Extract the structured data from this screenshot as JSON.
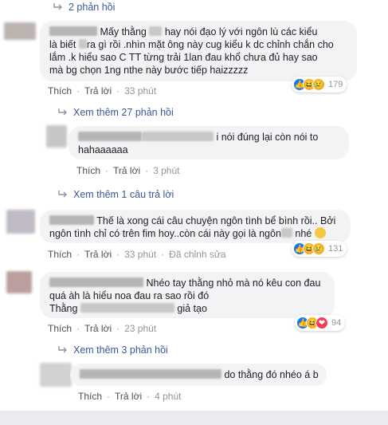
{
  "thread": {
    "top_replies_toggle": "2 phản hồi",
    "comments": [
      {
        "text_line1_a": "Mấy thằng",
        "text_line1_b": "hay nói đạo lý với ngôn lù các kiểu",
        "text_line2_a": "là biết",
        "text_line2_b": "ra gì rồi .nhìn mặt ông này cug kiểu k dc chỉnh chắn cho",
        "text_line3": "lắm .k hiểu sao C TT từng trải 1lan đau khổ chưa đủ hay sao",
        "text_line4": "mà bg chọn 1ng nthe này bước tiếp haizzzzz",
        "like": "Thích",
        "reply": "Trả lời",
        "time": "33 phút",
        "reaction_count": "179",
        "more_replies": "Xem thêm 27 phản hồi"
      },
      {
        "text_line1_a": "Th",
        "text_line1_b": "i nói đúng lại còn nói to",
        "text_line2": "hahaaaaaa",
        "like": "Thích",
        "reply": "Trả lời",
        "time": "3 phút",
        "more_replies": "Xem thêm 1 câu trả lời"
      },
      {
        "text_line1": "Thế là xong cái câu chuyện ngôn tình bể bình rồi.. Bởi",
        "text_line2_a": "ngôn tình chỉ có trên fim hoy..còn cái này gọi là ngôn",
        "text_line2_b": "nhé",
        "like": "Thích",
        "reply": "Trả lời",
        "time": "33 phút",
        "edited": "Đã chỉnh sửa",
        "reaction_count": "131"
      },
      {
        "text_line1": "Nhéo tay thằng nhỏ mà nó kêu con đau",
        "text_line2": "quá àh là hiểu noa đau ra sao rồi đó",
        "text_line3_a": "Thằng",
        "text_line3_b": "giả tạo",
        "like": "Thích",
        "reply": "Trả lời",
        "time": "23 phút",
        "reaction_count": "94",
        "more_replies": "Xem thêm 3 phản hồi"
      },
      {
        "text": "do thằng đó nhéo á b",
        "like": "Thích",
        "reply": "Trả lời",
        "time": "4 phút"
      }
    ]
  },
  "colors": {
    "link": "#385898",
    "bubble": "#f2f3f5",
    "meta": "#90949c",
    "like_blue": "#1877f2",
    "haha_yellow": "#f7b125",
    "love_red": "#f33e58",
    "page_bg_bottom": "#e9ebee"
  },
  "icons": [
    "reply-arrow-icon",
    "like-reaction-icon",
    "haha-reaction-icon",
    "sad-reaction-icon",
    "love-reaction-icon",
    "grin-emoji-icon"
  ]
}
